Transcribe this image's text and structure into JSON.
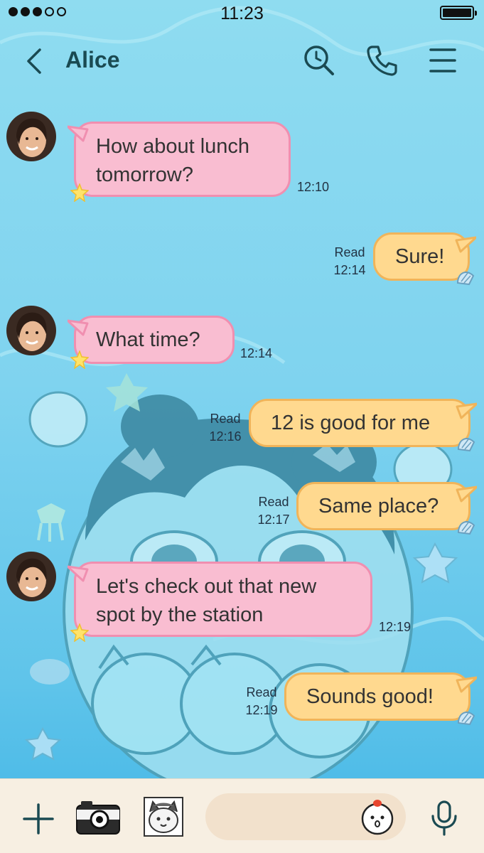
{
  "status_bar": {
    "time": "11:23",
    "signal_full": 3,
    "signal_total": 5
  },
  "header": {
    "title": "Alice",
    "icons": [
      "back-chevron-icon",
      "search-history-icon",
      "phone-icon",
      "menu-icon"
    ]
  },
  "messages": [
    {
      "side": "in",
      "lines": [
        "How about lunch",
        "tomorrow?"
      ],
      "time": "12:10"
    },
    {
      "side": "out",
      "lines": [
        "Sure!"
      ],
      "read": "Read",
      "time": "12:14"
    },
    {
      "side": "in",
      "lines": [
        "What time?"
      ],
      "time": "12:14"
    },
    {
      "side": "out",
      "lines": [
        "12 is good for me"
      ],
      "read": "Read",
      "time": "12:16"
    },
    {
      "side": "out",
      "lines": [
        "Same place?"
      ],
      "read": "Read",
      "time": "12:17"
    },
    {
      "side": "in",
      "lines": [
        "Let's check out that new",
        "spot by the station"
      ],
      "time": "12:19"
    },
    {
      "side": "out",
      "lines": [
        "Sounds good!"
      ],
      "read": "Read",
      "time": "12:19"
    }
  ],
  "input_bar": {
    "placeholder": "",
    "icons": [
      "plus-icon",
      "camera-icon",
      "photo-thumbnail-icon",
      "sticker-icon",
      "microphone-icon"
    ]
  },
  "colors": {
    "incoming_bubble": "#f9bdd1",
    "incoming_border": "#f08fb0",
    "outgoing_bubble": "#ffd98f",
    "outgoing_border": "#f0b45a",
    "header_text": "#1a4a52"
  }
}
